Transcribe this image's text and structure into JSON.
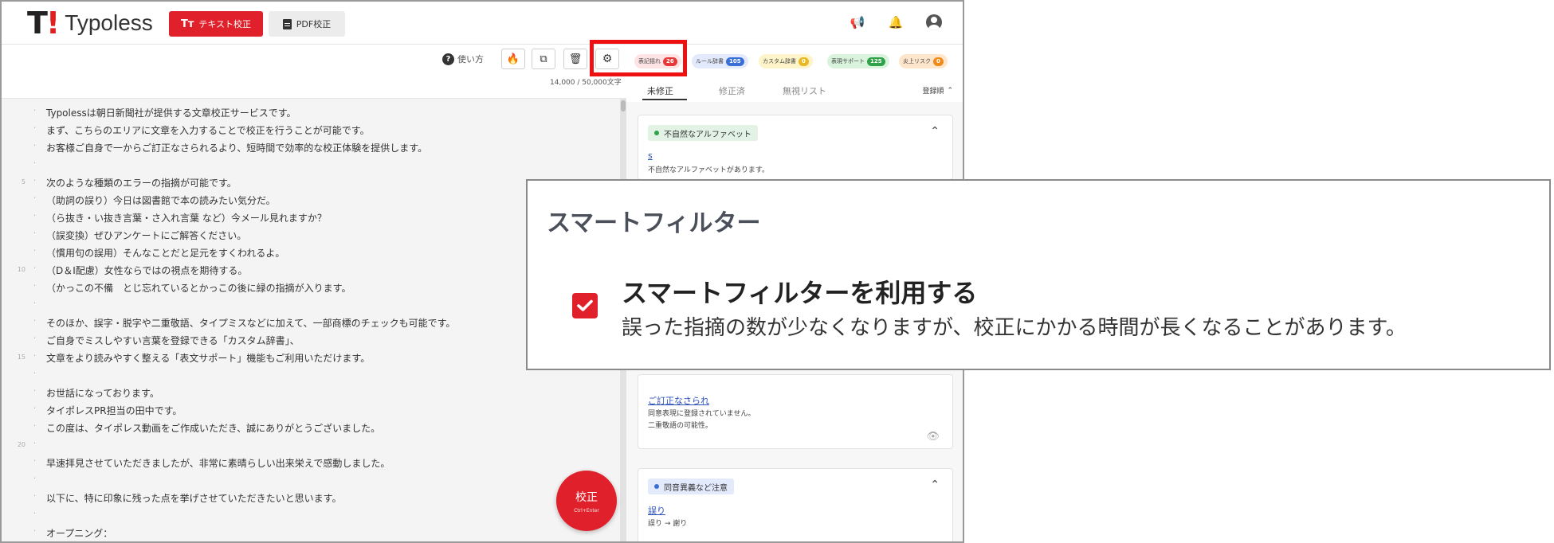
{
  "app": {
    "logo_mark": "T",
    "logo_text": "Typoless",
    "text_proof_icon": "Tт",
    "text_proof_label": "テキスト校正",
    "pdf_proof_label": "PDF校正"
  },
  "toolbar": {
    "help_label": "使い方",
    "count_label": "14,000 / 50,000文字",
    "chips": [
      {
        "label": "表記揺れ",
        "count": "26"
      },
      {
        "label": "ルール辞書",
        "count": "105"
      },
      {
        "label": "カスタム辞書",
        "count": "0"
      },
      {
        "label": "表現サポート",
        "count": "125"
      },
      {
        "label": "炎上リスク",
        "count": "0"
      }
    ]
  },
  "editor": {
    "lines": [
      {
        "n": "",
        "text": "Typolessは朝日新聞社が提供する文章校正サービスです。"
      },
      {
        "n": "",
        "text": "まず、こちらのエリアに文章を入力することで校正を行うことが可能です。"
      },
      {
        "n": "",
        "text": "お客様ご自身で一からご訂正なさられるより、短時間で効率的な校正体験を提供します。"
      },
      {
        "n": "",
        "text": ""
      },
      {
        "n": "5",
        "text": "次のような種類のエラーの指摘が可能です。"
      },
      {
        "n": "",
        "text": "（助詞の誤り）今日は図書館で本の読みたい気分だ。"
      },
      {
        "n": "",
        "text": "（ら抜き・い抜き言葉・さ入れ言葉 など）今メール見れますか？"
      },
      {
        "n": "",
        "text": "（誤変換）ぜひアンケートにご解答ください。"
      },
      {
        "n": "",
        "text": "（慣用句の誤用）そんなことだと足元をすくわれるよ。"
      },
      {
        "n": "10",
        "text": "（D＆I配慮）女性ならではの視点を期待する。"
      },
      {
        "n": "",
        "text": "（かっこの不備　とじ忘れているとかっこの後に緑の指摘が入ります。"
      },
      {
        "n": "",
        "text": ""
      },
      {
        "n": "",
        "text": "そのほか、誤字・脱字や二重敬語、タイプミスなどに加えて、一部商標のチェックも可能です。"
      },
      {
        "n": "",
        "text": "ご自身でミスしやすい言葉を登録できる「カスタム辞書」、"
      },
      {
        "n": "15",
        "text": "文章をより読みやすく整える「表文サポート」機能もご利用いただけます。"
      },
      {
        "n": "",
        "text": ""
      },
      {
        "n": "",
        "text": "お世話になっております。"
      },
      {
        "n": "",
        "text": "タイポレスPR担当の田中です。"
      },
      {
        "n": "",
        "text": "この度は、タイポレス動画をご作成いただき、誠にありがとうございました。"
      },
      {
        "n": "20",
        "text": ""
      },
      {
        "n": "",
        "text": "早速拝見させていただきましたが、非常に素晴らしい出来栄えで感動しました。"
      },
      {
        "n": "",
        "text": ""
      },
      {
        "n": "",
        "text": "以下に、特に印象に残った点を挙げさせていただきたいと思います。"
      },
      {
        "n": "",
        "text": ""
      },
      {
        "n": "",
        "text": "オープニング："
      }
    ],
    "fab_label": "校正",
    "fab_sub": "Ctrl+Enter"
  },
  "panel": {
    "tabs": [
      "未修正",
      "修正済",
      "無視リスト"
    ],
    "sort_label": "登録順",
    "cards": [
      {
        "head": "不自然なアルファベット",
        "word": "s",
        "desc": "不自然なアルファベットがあります。"
      },
      {
        "head": "",
        "word": "ご訂正なさられ",
        "desc": "同意表現に登録されていません。\n二重敬語の可能性。"
      },
      {
        "head": "同音異義など注意",
        "word": "誤り",
        "desc": "誤り → 謝り"
      }
    ]
  },
  "callout": {
    "title": "スマートフィルター",
    "option_label": "スマートフィルターを利用する",
    "option_desc": "誤った指摘の数が少なくなりますが、校正にかかる時間が長くなることがあります。",
    "checked": true
  },
  "colors": {
    "brand_red": "#e0202a",
    "highlight_red": "#ee1111"
  }
}
